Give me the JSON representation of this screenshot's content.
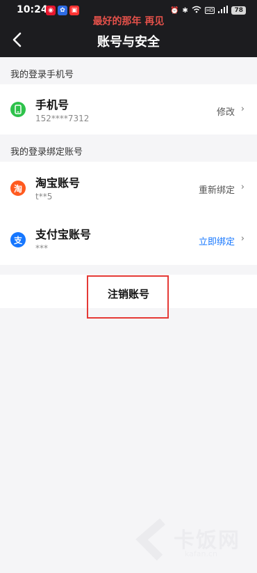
{
  "status_bar": {
    "time": "10:24",
    "banner": "最好的那年 再见",
    "battery": "78",
    "network_badge": "HD",
    "app_icons": [
      "weibo-icon",
      "baidu-icon",
      "red-app-icon"
    ],
    "system_icons": [
      "alarm-icon",
      "bluetooth-icon",
      "wifi-icon",
      "signal-icon"
    ]
  },
  "nav": {
    "title": "账号与安全",
    "back_icon": "chevron-left-icon"
  },
  "phone_section": {
    "header": "我的登录手机号",
    "item": {
      "title": "手机号",
      "subtitle": "152****7312",
      "action": "修改",
      "icon": "phone-icon",
      "icon_color": "#2ec24b"
    }
  },
  "bind_section": {
    "header": "我的登录绑定账号",
    "items": [
      {
        "title": "淘宝账号",
        "subtitle": "t**5",
        "action": "重新绑定",
        "icon": "taobao-icon",
        "icon_glyph": "淘",
        "icon_color": "#ff5a1f",
        "action_color": "#555555"
      },
      {
        "title": "支付宝账号",
        "subtitle": "***",
        "action": "立即绑定",
        "icon": "alipay-icon",
        "icon_glyph": "支",
        "icon_color": "#1677ff",
        "action_color": "#1677ff"
      }
    ]
  },
  "cancel_account": {
    "label": "注销账号"
  },
  "watermark": {
    "text": "卡饭网",
    "url": "kafan.cn"
  }
}
